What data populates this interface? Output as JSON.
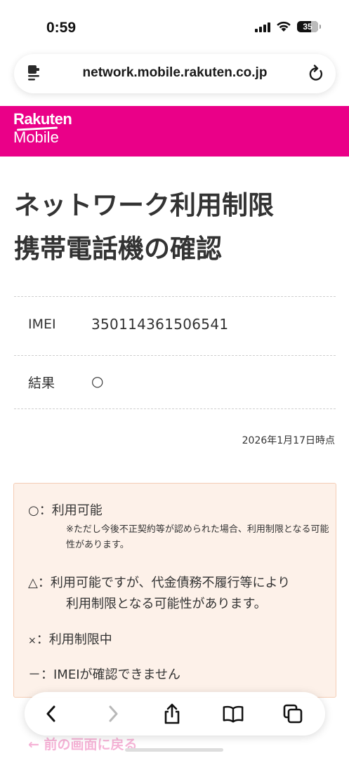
{
  "status_bar": {
    "time": "0:59",
    "battery": "35"
  },
  "browser": {
    "url": "network.mobile.rakuten.co.jp"
  },
  "brand": {
    "line1": "Rakuten",
    "line2": "Mobile",
    "color": "#ea0088"
  },
  "page": {
    "title_line1": "ネットワーク利用制限",
    "title_line2": "携帯電話機の確認",
    "rows": [
      {
        "label": "IMEI",
        "value": "350114361506541"
      },
      {
        "label": "結果",
        "value": "○"
      }
    ],
    "date": "2026年1月17日時点"
  },
  "legend": {
    "ok_symbol": "○",
    "ok_text": "：利用可能",
    "ok_note": "※ただし今後不正契約等が認められた場合、利用制限となる可能性があります。",
    "warn_symbol": "△",
    "warn_text": "：利用可能ですが、代金債務不履行等により",
    "warn_text2": "利用制限となる可能性があります。",
    "ng_symbol": "×",
    "ng_text": "：利用制限中",
    "na_symbol": "－",
    "na_text": "：IMEIが確認できません"
  },
  "footer": {
    "back_link": "← 前の画面に戻る"
  }
}
